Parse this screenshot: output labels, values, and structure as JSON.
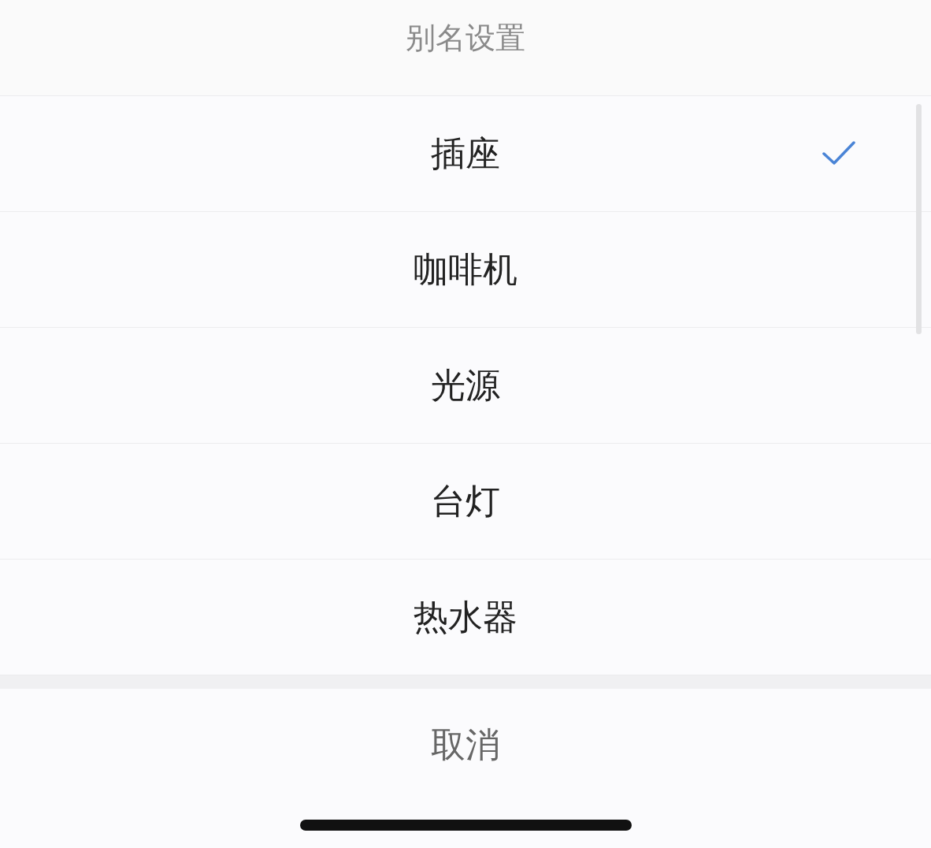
{
  "sheet": {
    "title": "别名设置",
    "options": [
      {
        "label": "插座",
        "selected": true
      },
      {
        "label": "咖啡机",
        "selected": false
      },
      {
        "label": "光源",
        "selected": false
      },
      {
        "label": "台灯",
        "selected": false
      },
      {
        "label": "热水器",
        "selected": false
      }
    ],
    "cancel": "取消"
  }
}
